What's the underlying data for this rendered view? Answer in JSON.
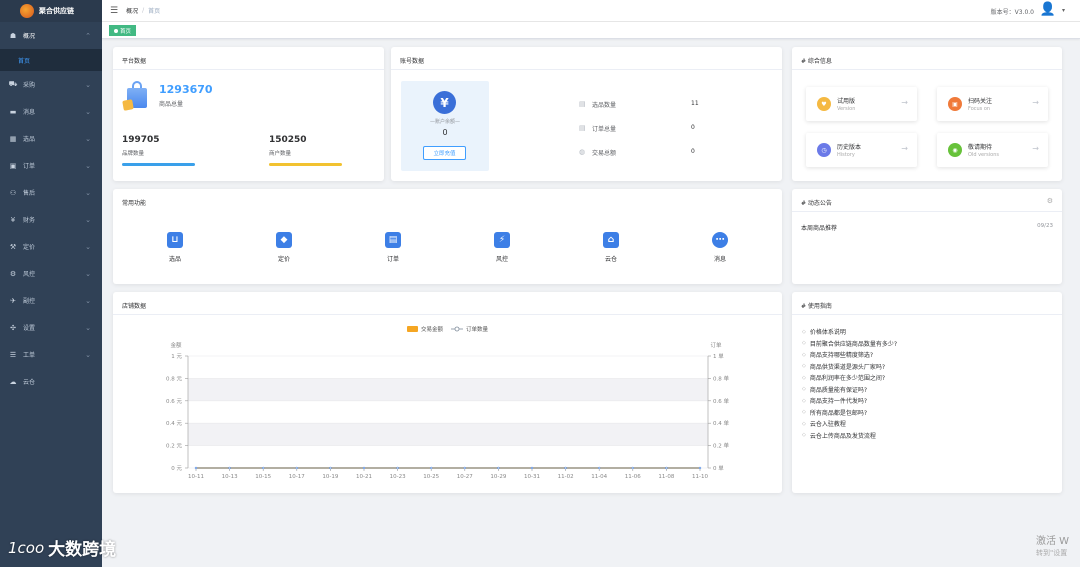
{
  "app": {
    "title": "聚合供应链"
  },
  "header": {
    "breadcrumb": [
      "概况",
      "首页"
    ],
    "version": "版本号：V3.0.0"
  },
  "tags": [
    {
      "label": "首页"
    }
  ],
  "sidebar": {
    "items": [
      {
        "label": "概况",
        "icon": "dashboard-icon"
      },
      {
        "label": "采购",
        "icon": "cart-icon"
      },
      {
        "label": "消息",
        "icon": "message-icon"
      },
      {
        "label": "选品",
        "icon": "product-icon"
      },
      {
        "label": "订单",
        "icon": "order-icon"
      },
      {
        "label": "售后",
        "icon": "aftersale-icon"
      },
      {
        "label": "财务",
        "icon": "finance-icon"
      },
      {
        "label": "定价",
        "icon": "pricing-icon"
      },
      {
        "label": "风控",
        "icon": "risk-icon"
      },
      {
        "label": "副控",
        "icon": "plane-icon"
      },
      {
        "label": "设置",
        "icon": "settings-icon"
      },
      {
        "label": "工单",
        "icon": "ticket-icon"
      },
      {
        "label": "云仓",
        "icon": "cloud-icon"
      }
    ],
    "sub_item": "首页"
  },
  "platform": {
    "title": "平台数据",
    "total": "1293670",
    "total_label": "商品总量",
    "brand": "199705",
    "brand_label": "品牌数量",
    "merchant": "150250",
    "merchant_label": "商户数量",
    "brand_color": "#3aa0ea",
    "merchant_color": "#f2c230"
  },
  "account": {
    "title": "账号数据",
    "balance_label": "—账户余额—",
    "balance": "0",
    "recharge": "立即充值",
    "rows": [
      {
        "label": "选品数量",
        "value": "11"
      },
      {
        "label": "订单总量",
        "value": "0"
      },
      {
        "label": "交易总额",
        "value": "0"
      }
    ]
  },
  "info": {
    "title": "# 综合信息",
    "items": [
      {
        "title": "试用版",
        "sub": "Version",
        "color": "#f5b942"
      },
      {
        "title": "扫码关注",
        "sub": "Focus on",
        "color": "#f07a3a"
      },
      {
        "title": "历史版本",
        "sub": "History",
        "color": "#6b7ae8"
      },
      {
        "title": "敬请期待",
        "sub": "Old versions",
        "color": "#67c23a"
      }
    ]
  },
  "functions": {
    "title": "常用功能",
    "items": [
      {
        "label": "选品",
        "icon": "shopping-bag-icon"
      },
      {
        "label": "定价",
        "icon": "price-tag-icon"
      },
      {
        "label": "订单",
        "icon": "clipboard-icon"
      },
      {
        "label": "风控",
        "icon": "shield-icon"
      },
      {
        "label": "云仓",
        "icon": "cloud-home-icon"
      },
      {
        "label": "消息",
        "icon": "chat-icon"
      }
    ]
  },
  "notice": {
    "title": "# 动态公告",
    "items": [
      {
        "text": "本周商品推荐",
        "date": "09/23"
      }
    ]
  },
  "guide": {
    "title": "# 使用指南",
    "items": [
      "价格体系说明",
      "目前聚合供应链商品数量有多少?",
      "商品支持哪些精度筛选?",
      "商品供货渠道是源头厂家吗?",
      "商品利润率在多少范围之间?",
      "商品质量能有保证吗?",
      "商品支持一件代发吗?",
      "所有商品都是包邮吗?",
      "云仓入驻教程",
      "云仓上传商品及发货流程"
    ]
  },
  "store": {
    "title": "店铺数据"
  },
  "chart_data": {
    "type": "line",
    "x": [
      "10-11",
      "10-13",
      "10-15",
      "10-17",
      "10-19",
      "10-21",
      "10-23",
      "10-25",
      "10-27",
      "10-29",
      "10-31",
      "11-02",
      "11-04",
      "11-06",
      "11-08",
      "11-10"
    ],
    "series": [
      {
        "name": "交易金额",
        "values": [
          0,
          0,
          0,
          0,
          0,
          0,
          0,
          0,
          0,
          0,
          0,
          0,
          0,
          0,
          0,
          0
        ],
        "color": "#f5a623",
        "axis": "left"
      },
      {
        "name": "订单数量",
        "values": [
          0,
          0,
          0,
          0,
          0,
          0,
          0,
          0,
          0,
          0,
          0,
          0,
          0,
          0,
          0,
          0
        ],
        "color": "#7f8c9b",
        "axis": "right"
      }
    ],
    "ylabel_left": "金额",
    "ylabel_right": "订单",
    "ylim": [
      0,
      1
    ],
    "yticks_left": [
      "0 元",
      "0.2 元",
      "0.4 元",
      "0.6 元",
      "0.8 元",
      "1 元"
    ],
    "yticks_right": [
      "0 单",
      "0.2 单",
      "0.4 单",
      "0.6 单",
      "0.8 单",
      "1 单"
    ],
    "grid": true,
    "legend": "top-center"
  },
  "watermark": {
    "text": "大数跨境",
    "symbol": "1ᴄoo"
  },
  "activation": {
    "line1": "激活 W",
    "line2": "转到\"设置"
  }
}
